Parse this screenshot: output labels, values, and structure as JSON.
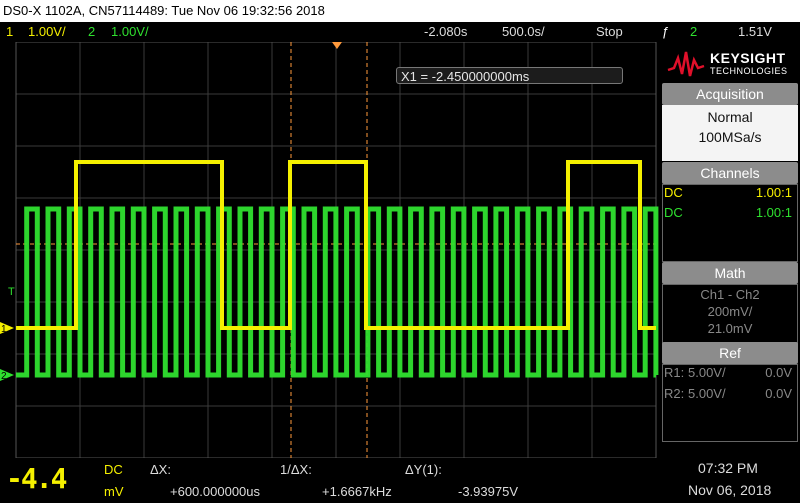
{
  "title": "DS0-X 1102A, CN57114489: Tue Nov 06 19:32:56 2018",
  "topbar": {
    "ch1_num": "1",
    "ch1_scale": "1.00V/",
    "ch2_num": "2",
    "ch2_scale": "1.00V/",
    "time_offset": "-2.080s",
    "time_scale": "500.0s/",
    "run_state": "Stop",
    "trigger_symbol": "ƒ",
    "trigger_channel": "2",
    "trigger_level": "1.51V"
  },
  "cursor_readout": "X1 = -2.450000000ms",
  "brand": {
    "name": "KEYSIGHT",
    "sub": "TECHNOLOGIES"
  },
  "acquisition": {
    "header": "Acquisition",
    "mode": "Normal",
    "rate": "100MSa/s"
  },
  "channels": {
    "header": "Channels",
    "rows": [
      {
        "coupling": "DC",
        "probe": "1.00:1",
        "color": "#f5f000"
      },
      {
        "coupling": "DC",
        "probe": "1.00:1",
        "color": "#2fe02f"
      }
    ]
  },
  "math": {
    "header": "Math",
    "expr": "Ch1 - Ch2",
    "scale": "200mV/",
    "offset": "21.0mV"
  },
  "ref": {
    "header": "Ref",
    "rows": [
      {
        "name": "R1:",
        "scale": "5.00V/",
        "offset": "0.0V"
      },
      {
        "name": "R2:",
        "scale": "5.00V/",
        "offset": "0.0V"
      }
    ]
  },
  "markers": {
    "trigger": "T",
    "ch1": "1",
    "ch2": "2"
  },
  "bottom": {
    "meter_value": "-4.4",
    "meter_coupling": "DC",
    "meter_unit": "mV",
    "dx_label": "ΔX:",
    "dx_value": "+600.000000us",
    "inv_dx_label": "1/ΔX:",
    "inv_dx_value": "+1.6667kHz",
    "dy_label": "ΔY(1):",
    "dy_value": "-3.93975V",
    "time": "07:32 PM",
    "date": "Nov 06, 2018"
  },
  "colors": {
    "ch1": "#f5f000",
    "ch2": "#2fe02f",
    "cursor": "#ff9a3c",
    "grid": "#3a3a3a"
  }
}
